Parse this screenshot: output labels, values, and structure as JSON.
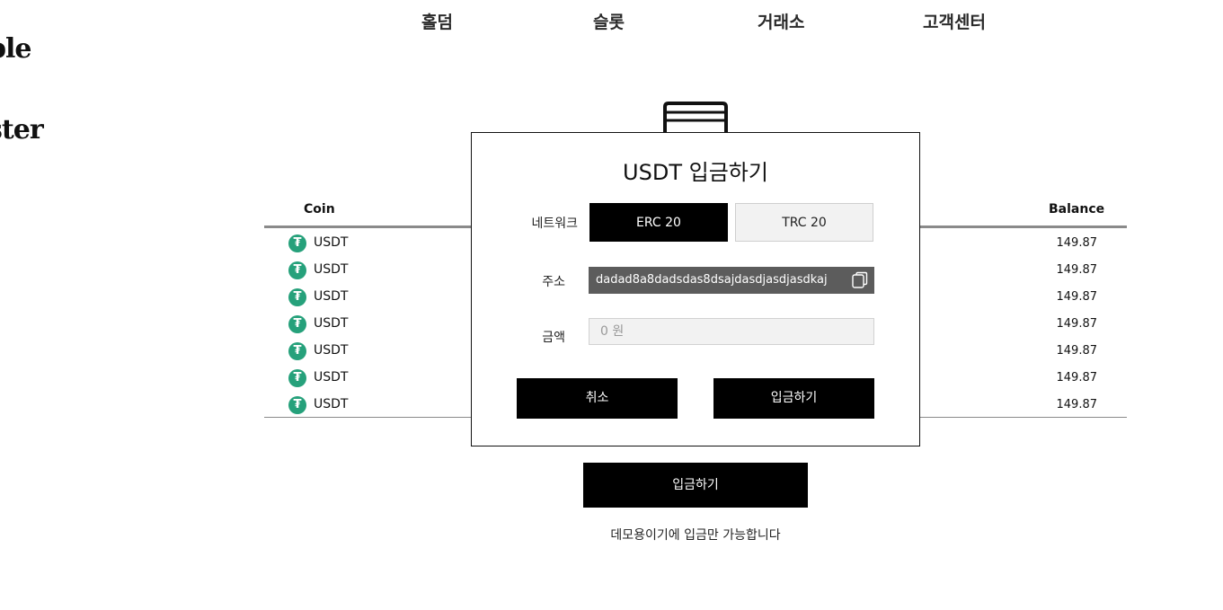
{
  "logo": {
    "line1": "ble",
    "line2": "ster"
  },
  "nav": {
    "items": [
      {
        "label": "홀덤"
      },
      {
        "label": "슬롯"
      },
      {
        "label": "거래소"
      },
      {
        "label": "고객센터"
      }
    ]
  },
  "table": {
    "headers": {
      "coin": "Coin",
      "balance": "Balance"
    },
    "rows": [
      {
        "coin": "USDT",
        "balance": "149.87"
      },
      {
        "coin": "USDT",
        "balance": "149.87"
      },
      {
        "coin": "USDT",
        "balance": "149.87"
      },
      {
        "coin": "USDT",
        "balance": "149.87"
      },
      {
        "coin": "USDT",
        "balance": "149.87"
      },
      {
        "coin": "USDT",
        "balance": "149.87"
      },
      {
        "coin": "USDT",
        "balance": "149.87"
      }
    ],
    "coin_icon_glyph": "₮",
    "coin_icon_color": "#26a17b"
  },
  "main": {
    "deposit_label": "입금하기",
    "demo_note": "데모용이기에 입금만 가능합니다"
  },
  "modal": {
    "title": "USDT 입금하기",
    "network_label": "네트워크",
    "networks": [
      {
        "label": "ERC 20",
        "selected": true
      },
      {
        "label": "TRC 20",
        "selected": false
      }
    ],
    "address_label": "주소",
    "address_value": "dadad8a8dadsdas8dsajdasdjasdjasdkaj",
    "amount_label": "금액",
    "amount_placeholder": "0 원",
    "amount_value": "",
    "cancel_label": "취소",
    "confirm_label": "입금하기"
  },
  "icons": {
    "wallet": "wallet-icon",
    "copy": "copy-icon",
    "coin": "tether-icon"
  }
}
